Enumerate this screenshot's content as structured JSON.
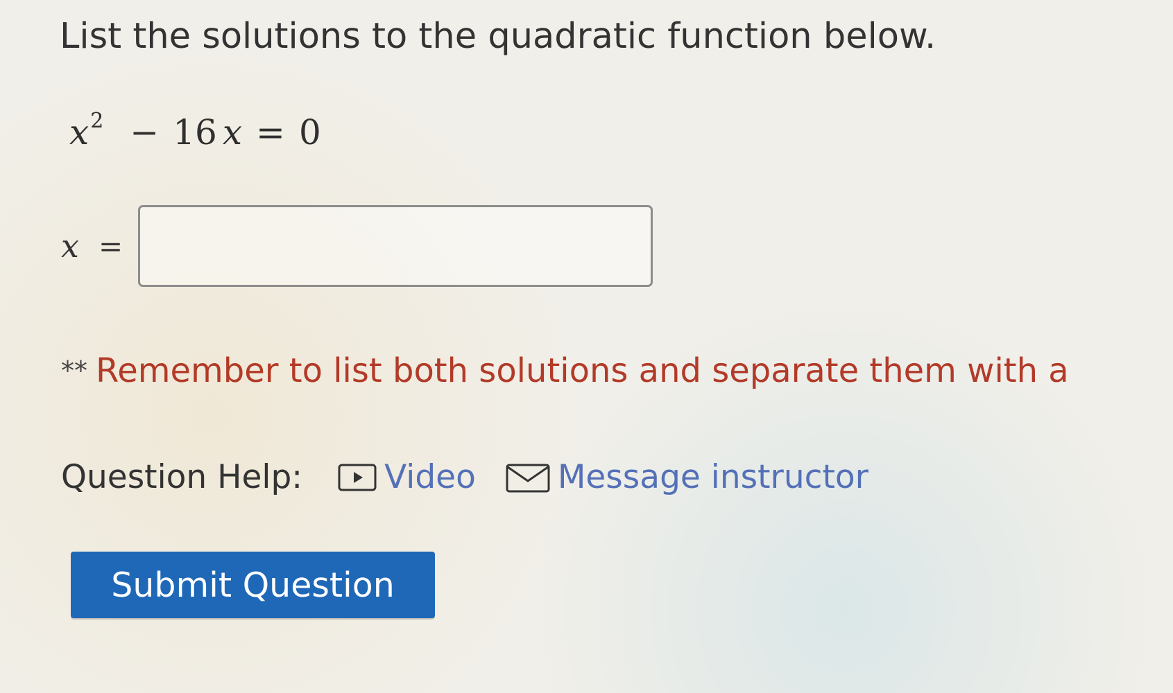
{
  "question": {
    "title": "List the solutions to the quadratic function below."
  },
  "equation": {
    "variable": "x",
    "exponent": "2",
    "minus": "−",
    "coefficient": "16",
    "equals": "=",
    "rhs": "0"
  },
  "answer": {
    "variable": "x",
    "equals": "=",
    "value": "",
    "placeholder": ""
  },
  "reminder": {
    "mark": "**",
    "text": "Remember to list both solutions and separate them with a"
  },
  "help": {
    "label": "Question Help:",
    "video_label": "Video",
    "message_label": "Message instructor",
    "video_icon": "play-icon",
    "message_icon": "mail-icon"
  },
  "submit": {
    "label": "Submit Question"
  },
  "colors": {
    "reminder": "#b33a28",
    "link": "#5470b8",
    "submit_bg": "#1f68b8"
  }
}
